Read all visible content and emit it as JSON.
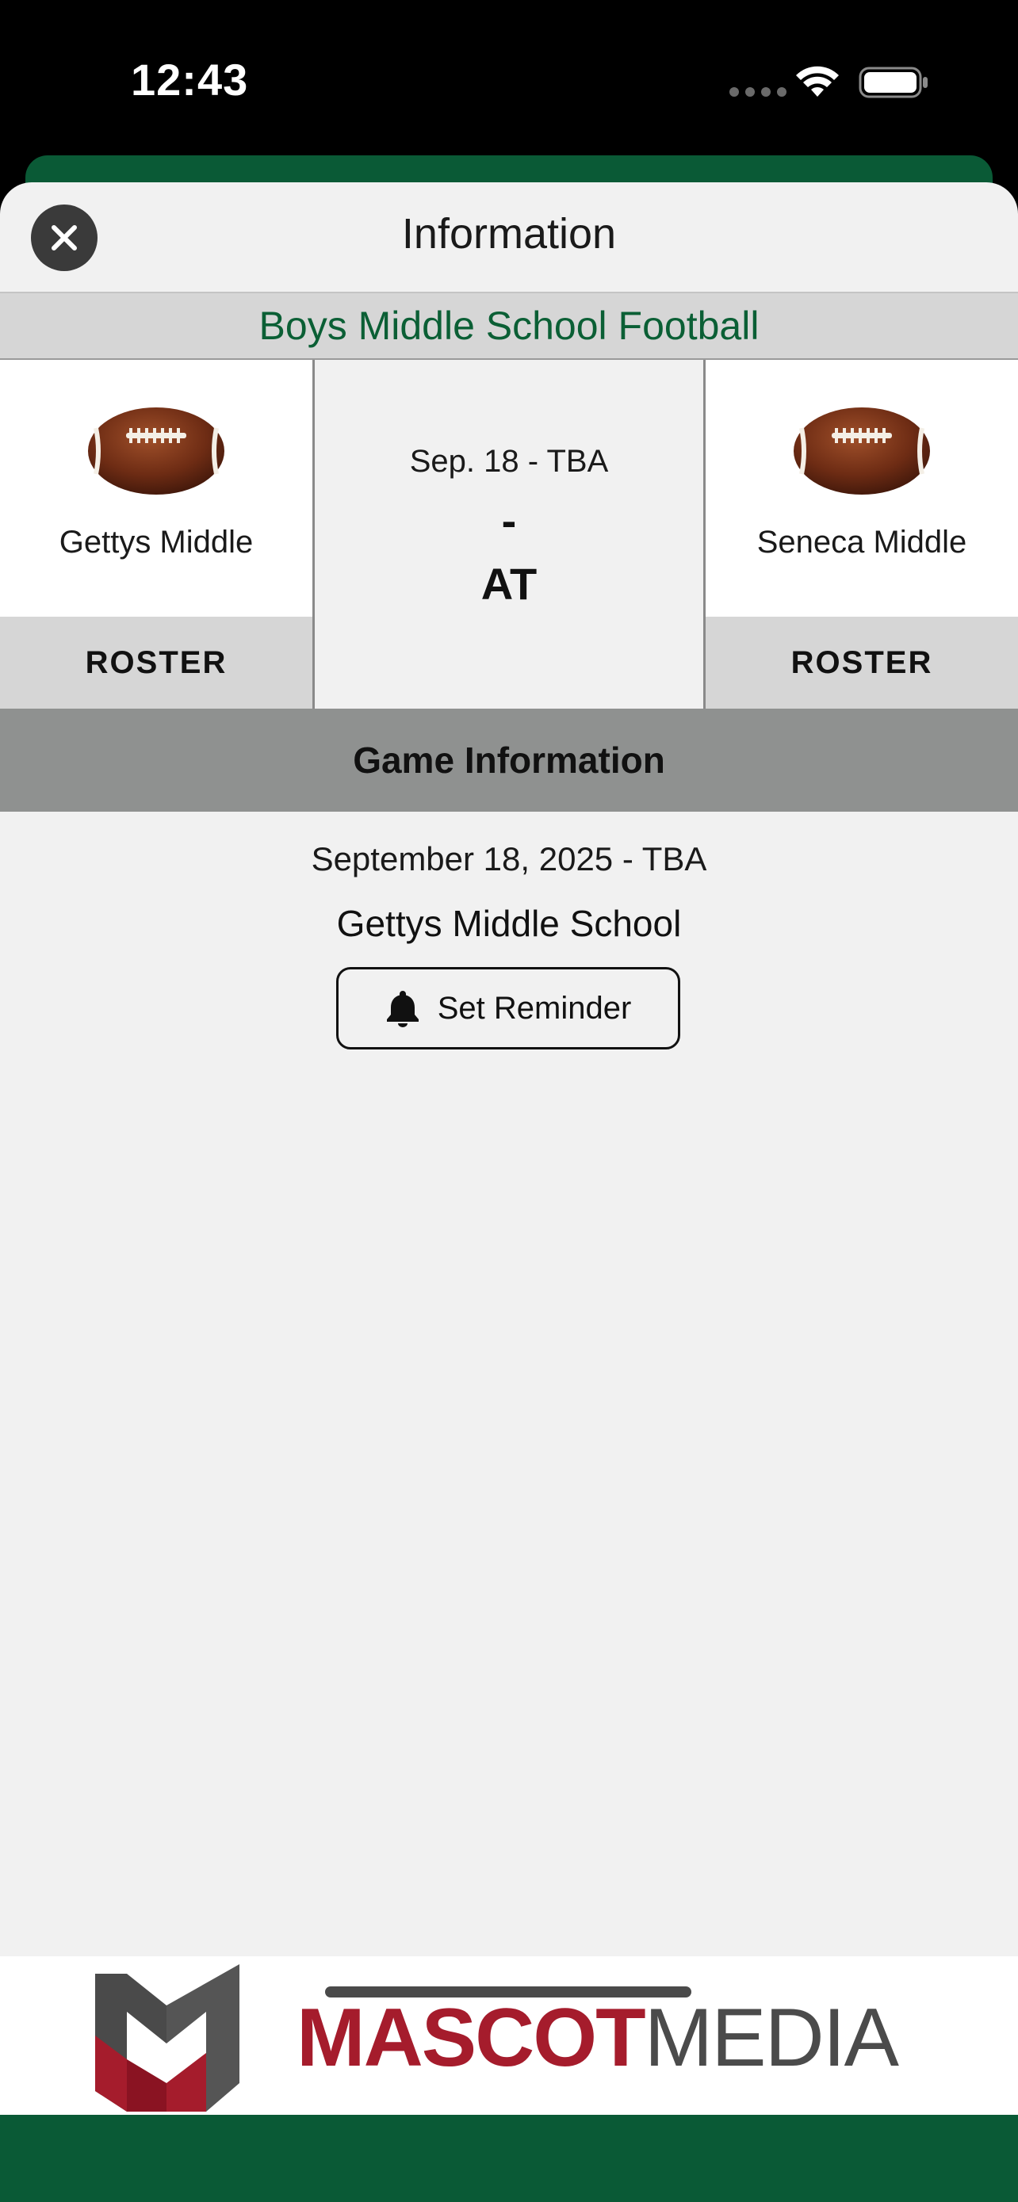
{
  "status_bar": {
    "time": "12:43"
  },
  "header": {
    "title": "Information"
  },
  "sport": {
    "name": "Boys Middle School Football"
  },
  "matchup": {
    "home": {
      "name": "Gettys Middle",
      "roster_label": "ROSTER"
    },
    "away": {
      "name": "Seneca Middle",
      "roster_label": "ROSTER"
    },
    "date_time": "Sep. 18 - TBA",
    "score": "-",
    "vs_label": "AT"
  },
  "game_info": {
    "section_title": "Game Information",
    "date": "September 18, 2025 - TBA",
    "venue": "Gettys Middle School",
    "reminder_label": "Set Reminder"
  },
  "sponsor": {
    "part1": "MASCOT",
    "part2": "MEDIA"
  },
  "colors": {
    "accent_green": "#0b5f35",
    "brand_red": "#a51c2c"
  },
  "icons": [
    "close-icon",
    "football-icon",
    "bell-icon",
    "wifi-icon",
    "battery-icon"
  ]
}
